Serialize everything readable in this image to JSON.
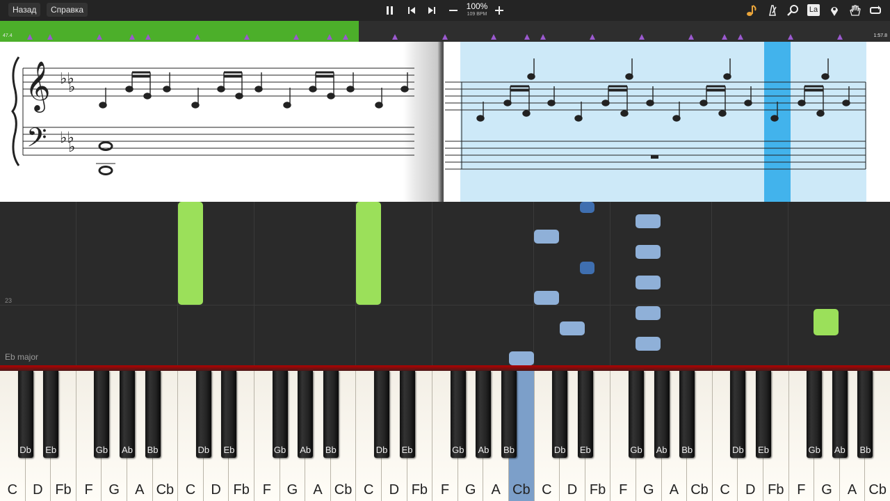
{
  "toolbar": {
    "back_label": "Назад",
    "help_label": "Справка",
    "tempo_percent": "100%",
    "tempo_bpm": "109 BPM",
    "hand_label": "La"
  },
  "timeline": {
    "start_time": "47.4",
    "end_time": "1:57.8",
    "progress_fraction": 0.403
  },
  "score": {
    "key_signature": "Eb major",
    "measure_number": "23"
  },
  "colors": {
    "progress": "#4caf2a",
    "marker": "#9b59d0",
    "note_green": "#9be05a",
    "note_light_blue": "#8fb0d8",
    "note_dark_blue": "#3f6fb0",
    "score_highlight": "#cde9f8",
    "score_cursor": "#42b3ec",
    "active_key": "#7c9fc9"
  },
  "keyboard": {
    "white_keys": [
      "C",
      "D",
      "Fb",
      "F",
      "G",
      "A",
      "Cb",
      "C",
      "D",
      "Fb",
      "F",
      "G",
      "A",
      "Cb",
      "C",
      "D",
      "Fb",
      "F",
      "G",
      "A",
      "Cb",
      "C",
      "D",
      "Fb",
      "F",
      "G",
      "A",
      "Cb",
      "C",
      "D",
      "Fb",
      "F",
      "G",
      "A",
      "Cb"
    ],
    "black_keys": [
      "Db",
      "Eb",
      "Gb",
      "Ab",
      "Bb",
      "Db",
      "Eb",
      "Gb",
      "Ab",
      "Bb",
      "Db",
      "Eb",
      "Gb",
      "Ab",
      "Bb",
      "Db",
      "Eb",
      "Gb",
      "Ab",
      "Bb",
      "Db",
      "Eb",
      "Gb",
      "Ab",
      "Bb"
    ],
    "active_white_key": "Cb"
  }
}
